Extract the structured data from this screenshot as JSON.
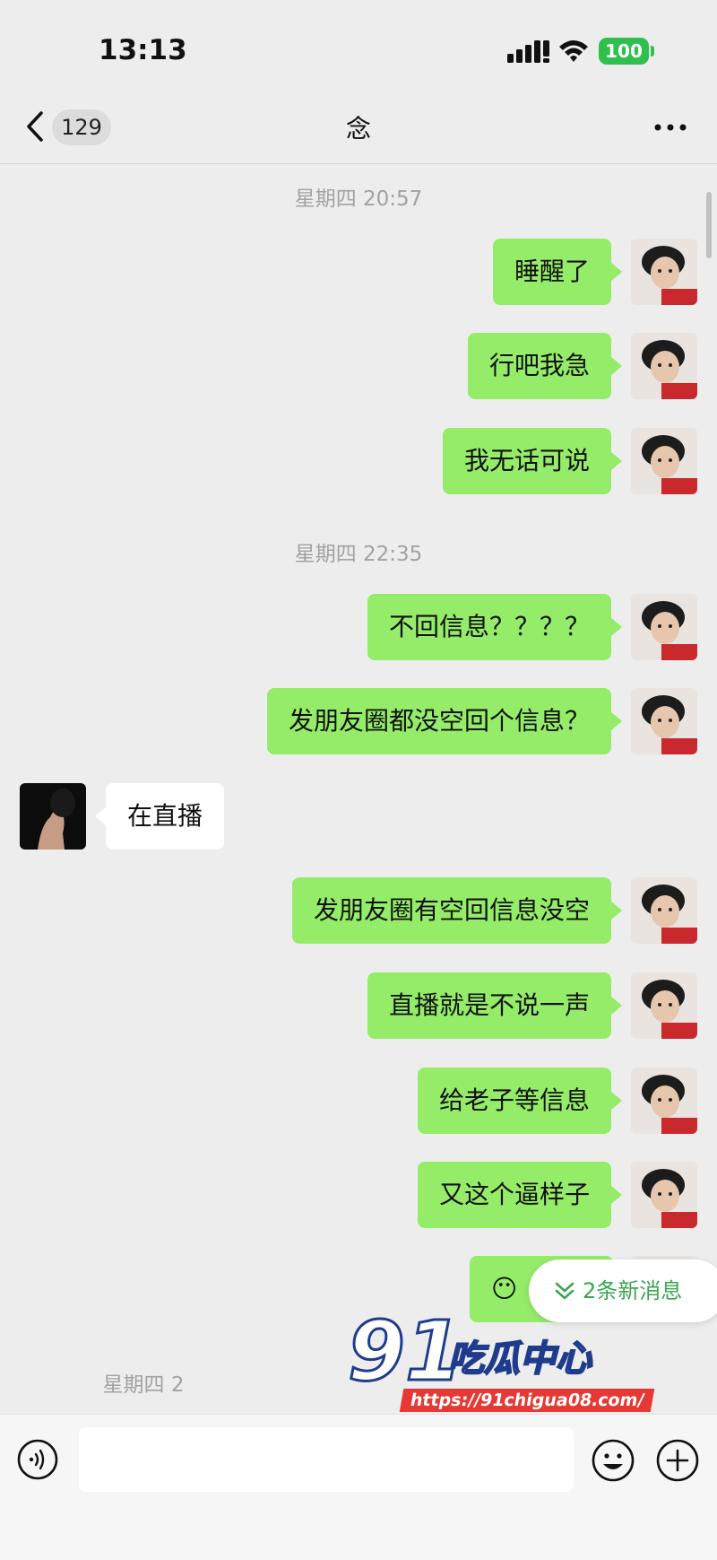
{
  "status_bar": {
    "time": "13:13",
    "battery": "100"
  },
  "header": {
    "unread_count": "129",
    "title": "念"
  },
  "timestamps": [
    "星期四 20:57",
    "星期四 22:35",
    "星期四 2"
  ],
  "messages": [
    {
      "sender": "me",
      "text": "睡醒了"
    },
    {
      "sender": "me",
      "text": "行吧我急"
    },
    {
      "sender": "me",
      "text": "我无话可说"
    },
    {
      "sender": "me",
      "text": "不回信息？？？？"
    },
    {
      "sender": "me",
      "text": "发朋友圈都没空回个信息？"
    },
    {
      "sender": "other",
      "text": "在直播"
    },
    {
      "sender": "me",
      "text": "发朋友圈有空回信息没空"
    },
    {
      "sender": "me",
      "text": "直播就是不说一声"
    },
    {
      "sender": "me",
      "text": "给老子等信息"
    },
    {
      "sender": "me",
      "text": "又这个逼样子"
    },
    {
      "sender": "me",
      "text": "😶"
    }
  ],
  "new_messages": {
    "label": "2条新消息"
  },
  "watermark": {
    "brand": "91吃瓜中心",
    "url": "https://91chigua08.com/"
  },
  "colors": {
    "my_bubble": "#95ec69",
    "other_bubble": "#ffffff",
    "background": "#ededed",
    "accent": "#3aa552"
  }
}
